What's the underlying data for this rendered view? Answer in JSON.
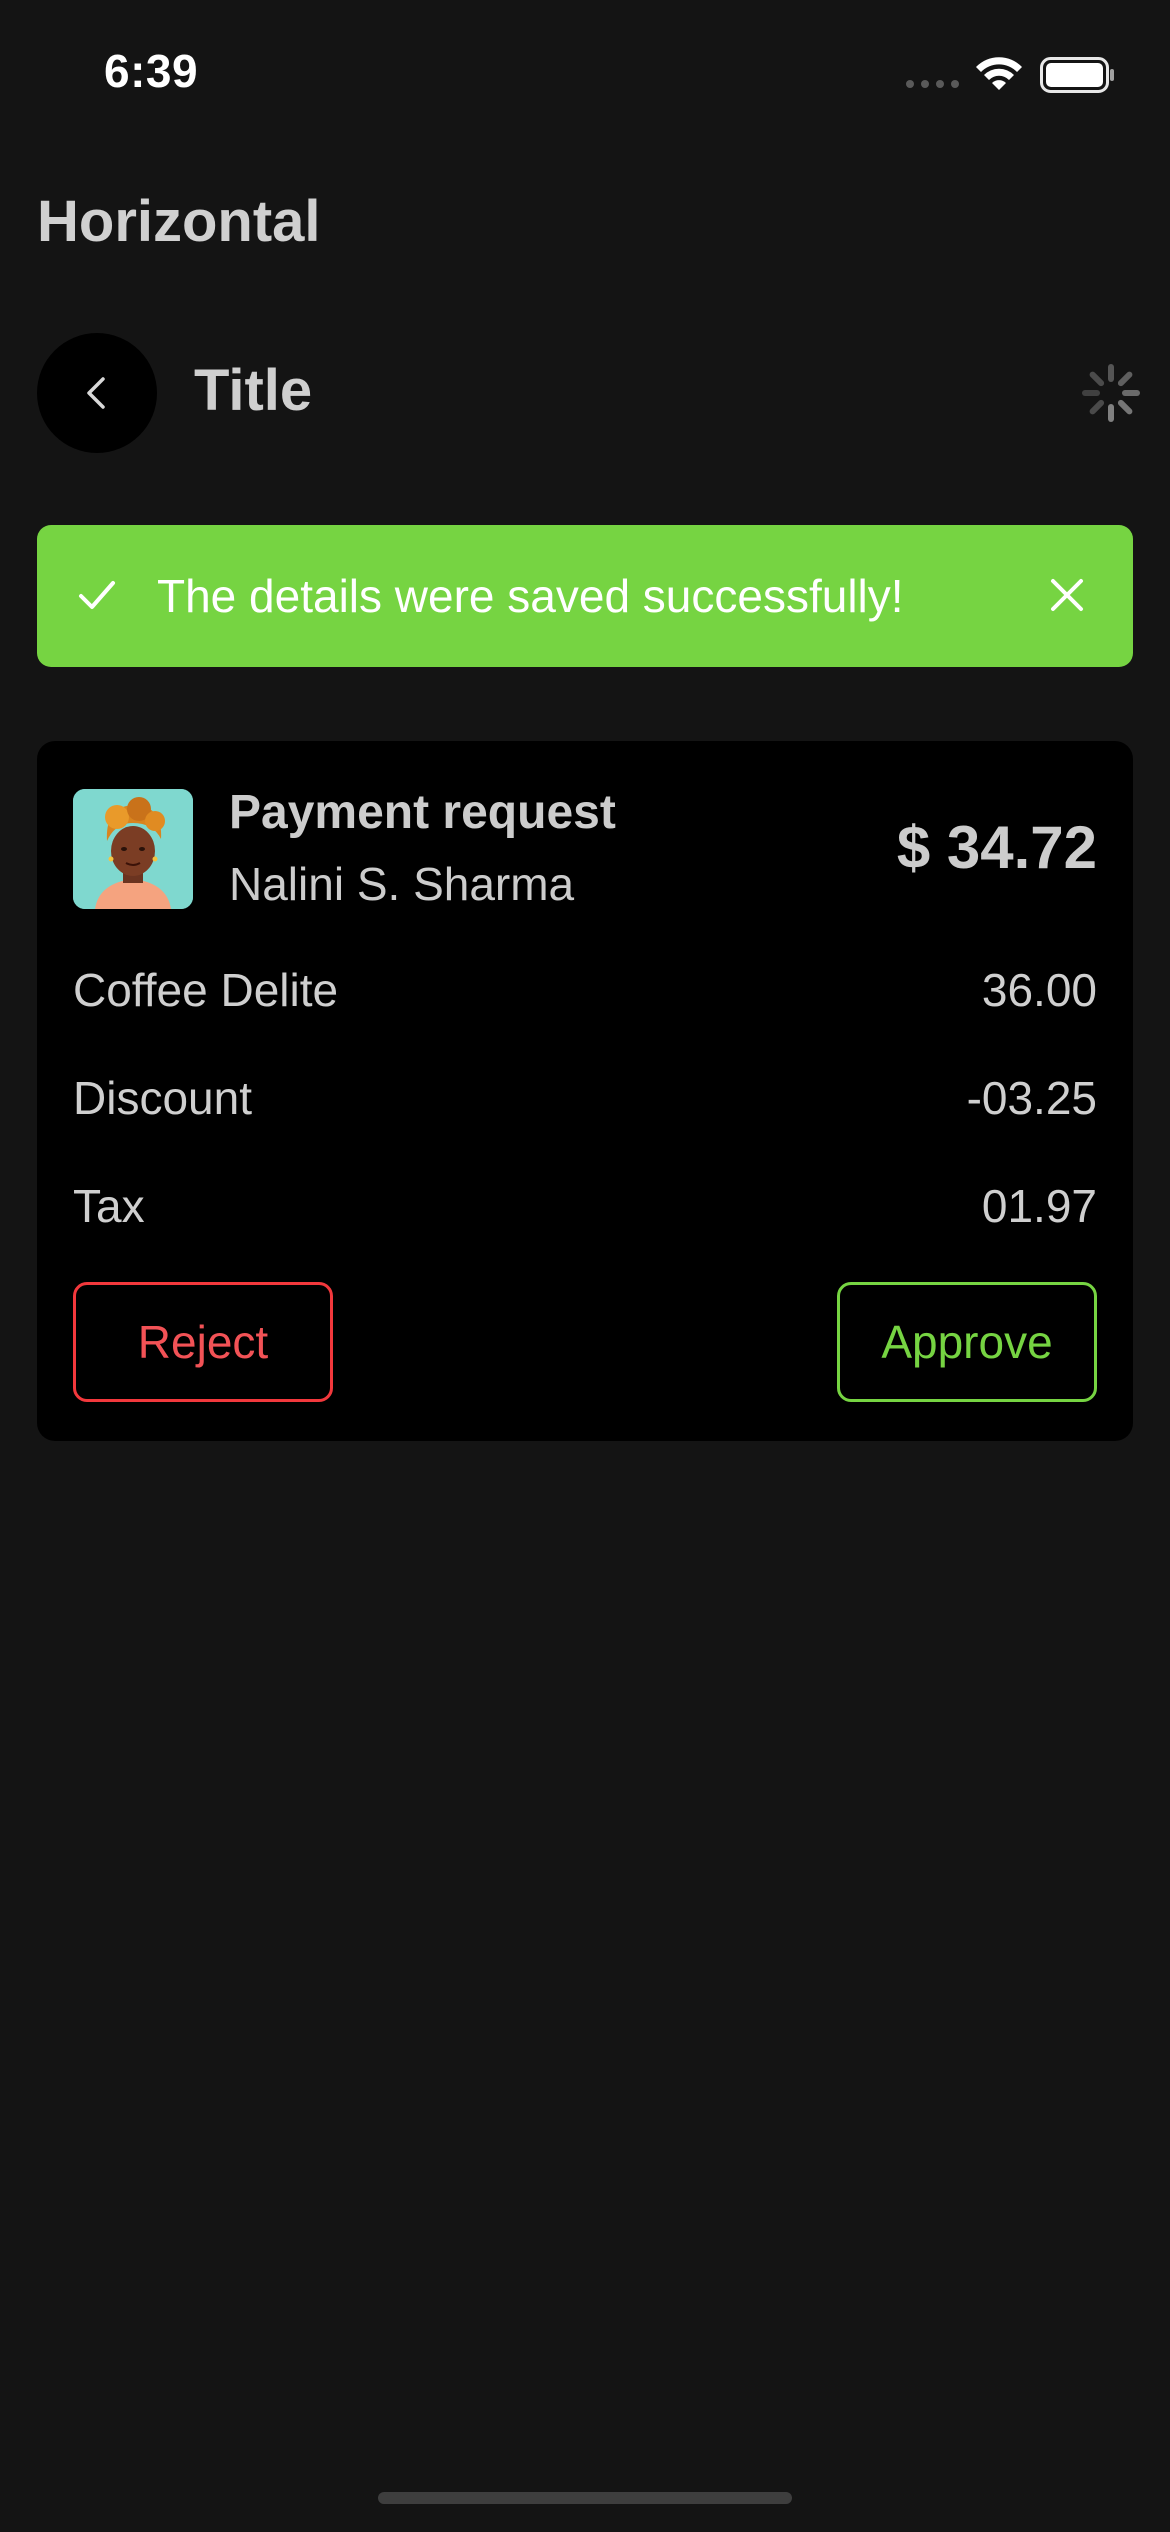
{
  "status_bar": {
    "time": "6:39"
  },
  "screen": {
    "heading": "Horizontal"
  },
  "nav": {
    "title": "Title",
    "back_icon": "chevron-left-icon",
    "loading_icon": "spinner-icon"
  },
  "toast": {
    "message": "The details were saved successfully!",
    "status": "success",
    "color": "#76d442"
  },
  "payment_card": {
    "title": "Payment request",
    "requester": "Nalini S. Sharma",
    "amount": "$ 34.72",
    "line_items": [
      {
        "label": "Coffee Delite",
        "value": "36.00"
      },
      {
        "label": "Discount",
        "value": "-03.25"
      },
      {
        "label": "Tax",
        "value": "01.97"
      }
    ],
    "reject_label": "Reject",
    "approve_label": "Approve",
    "reject_color": "#f2383c",
    "approve_color": "#76d442"
  }
}
